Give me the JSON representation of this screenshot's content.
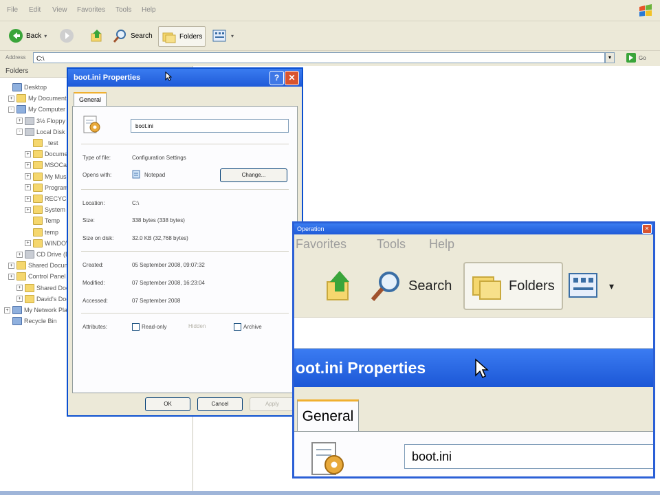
{
  "explorer": {
    "menu": [
      "File",
      "Edit",
      "View",
      "Favorites",
      "Tools",
      "Help"
    ],
    "toolbar": {
      "back_label": "Back",
      "search_label": "Search",
      "folders_label": "Folders"
    },
    "address": {
      "label": "Address",
      "value": "C:\\",
      "go_label": "Go"
    },
    "folders_header": "Folders",
    "tree": [
      {
        "label": "Desktop",
        "icon": "desktop-icon",
        "expander": ""
      },
      {
        "label": "My Documents",
        "icon": "folder-icon",
        "expander": "+"
      },
      {
        "label": "My Computer",
        "icon": "computer-icon",
        "expander": "-"
      },
      {
        "label": "3½ Floppy (A:)",
        "icon": "drive-icon",
        "expander": "+"
      },
      {
        "label": "Local Disk (C:)",
        "icon": "drive-icon",
        "expander": "-"
      },
      {
        "label": "_test",
        "icon": "folder-icon",
        "expander": ""
      },
      {
        "label": "Documents and Settings",
        "icon": "folder-icon",
        "expander": "+"
      },
      {
        "label": "MSOCache",
        "icon": "folder-icon",
        "expander": "+"
      },
      {
        "label": "My Music",
        "icon": "folder-icon",
        "expander": "+"
      },
      {
        "label": "Program Files",
        "icon": "folder-icon",
        "expander": "+"
      },
      {
        "label": "RECYCLER",
        "icon": "folder-icon",
        "expander": "+"
      },
      {
        "label": "System Volume Information",
        "icon": "folder-icon",
        "expander": "+"
      },
      {
        "label": "Temp",
        "icon": "folder-icon",
        "expander": ""
      },
      {
        "label": "temp",
        "icon": "folder-icon",
        "expander": ""
      },
      {
        "label": "WINDOWS",
        "icon": "folder-icon",
        "expander": "+"
      },
      {
        "label": "CD Drive (D:)",
        "icon": "drive-icon",
        "expander": "+"
      },
      {
        "label": "Shared Documents",
        "icon": "folder-icon",
        "expander": "+"
      },
      {
        "label": "Control Panel",
        "icon": "folder-icon",
        "expander": "+"
      },
      {
        "label": "Shared Documents",
        "icon": "folder-icon",
        "expander": "+"
      },
      {
        "label": "David's Documents",
        "icon": "folder-icon",
        "expander": "+"
      },
      {
        "label": "My Network Places",
        "icon": "network-icon",
        "expander": "+"
      },
      {
        "label": "Recycle Bin",
        "icon": "recycle-bin-icon",
        "expander": ""
      }
    ]
  },
  "dialog": {
    "title": "boot.ini Properties",
    "tab": "General",
    "filename": "boot.ini",
    "rows": {
      "type_label": "Type of file:",
      "type_value": "Configuration Settings",
      "opens_label": "Opens with:",
      "opens_value": "Notepad",
      "location_label": "Location:",
      "location_value": "C:\\",
      "size_label": "Size:",
      "size_value": "338 bytes (338 bytes)",
      "size_disk_label": "Size on disk:",
      "size_disk_value": "32.0 KB (32,768 bytes)",
      "created_label": "Created:",
      "created_value": "05 September 2008, 09:07:32",
      "modified_label": "Modified:",
      "modified_value": "07 September 2008, 16:23:04",
      "accessed_label": "Accessed:",
      "accessed_value": "07 September 2008",
      "attributes_label": "Attributes:"
    },
    "change_label": "Change...",
    "readonly_label": "Read-only",
    "hidden_label": "Hidden",
    "archive_label": "Archive",
    "ok_label": "OK",
    "cancel_label": "Cancel",
    "apply_label": "Apply"
  },
  "zoom": {
    "title": "Operation",
    "menu": [
      "Favorites",
      "Tools",
      "Help"
    ],
    "search_label": "Search",
    "folders_label": "Folders",
    "titlebar": "oot.ini Properties",
    "tab": "General",
    "filename": "boot.ini"
  },
  "colors": {
    "titlebar_blue": "#1f5ad8",
    "window_face": "#ece9d8",
    "tab_highlight": "#f0b030"
  }
}
